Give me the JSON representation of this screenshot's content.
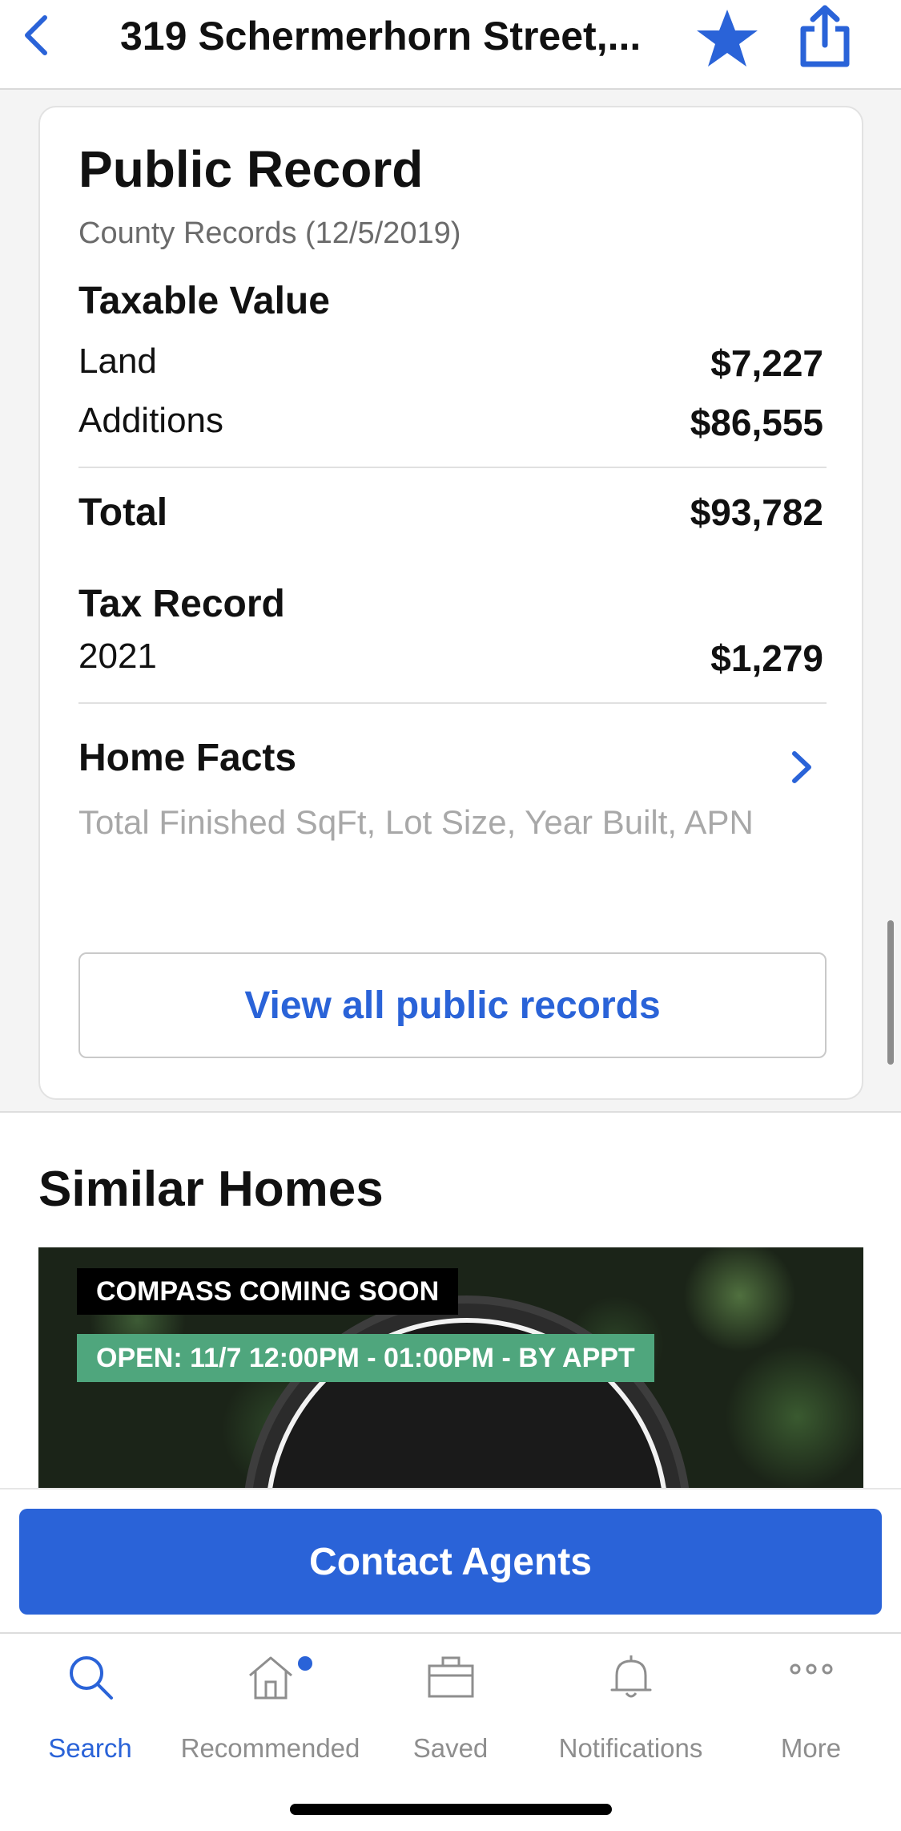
{
  "header": {
    "title": "319 Schermerhorn Street,...",
    "back_icon": "chevron-left-icon",
    "favorite_icon": "star-icon",
    "share_icon": "share-icon"
  },
  "public_record": {
    "title": "Public Record",
    "subtitle": "County Records (12/5/2019)",
    "taxable_value": {
      "label": "Taxable Value",
      "land_label": "Land",
      "land_value": "$7,227",
      "additions_label": "Additions",
      "additions_value": "$86,555",
      "total_label": "Total",
      "total_value": "$93,782"
    },
    "tax_record": {
      "label": "Tax Record",
      "year": "2021",
      "value": "$1,279"
    },
    "home_facts": {
      "label": "Home Facts",
      "subtitle": "Total Finished SqFt, Lot Size, Year Built, APN"
    },
    "view_all_label": "View all public records"
  },
  "similar_homes": {
    "title": "Similar Homes",
    "badge_status": "COMPASS COMING SOON",
    "badge_open": "OPEN: 11/7 12:00PM - 01:00PM - BY APPT"
  },
  "contact": {
    "label": "Contact Agents"
  },
  "tabbar": {
    "items": [
      {
        "label": "Search",
        "icon": "search-icon",
        "active": true
      },
      {
        "label": "Recommended",
        "icon": "home-icon",
        "active": false
      },
      {
        "label": "Saved",
        "icon": "briefcase-icon",
        "active": false
      },
      {
        "label": "Notifications",
        "icon": "bell-icon",
        "active": false
      },
      {
        "label": "More",
        "icon": "more-icon",
        "active": false
      }
    ]
  },
  "colors": {
    "accent": "#2a63d8",
    "badge_green": "#4fa67d"
  }
}
